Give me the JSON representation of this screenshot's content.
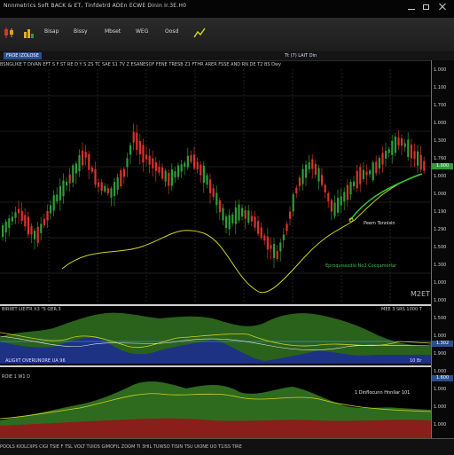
{
  "window": {
    "title": "Nnnmetrics Soft BACK & ET, Tinfdetrd ADEn ECWE Dinin Ir.3E.H0"
  },
  "toolbar": {
    "items": [
      "Bisap",
      "Bissy",
      "Mbset",
      "WEG",
      "Oosd"
    ],
    "icons": [
      "candle-icon",
      "bar-icon",
      "chart-icon"
    ]
  },
  "tabs": [
    "FROE IZOLOSE",
    "Tt (7) LAIT Din"
  ],
  "info_row": "BSNGLIKE T DIVAN  EFT S F ST RE D Y S ZS TC SAE S1 7V Z  ESANESOF FENE  TRESB Z1 FTHR ARER  FSSE AND RN DE T2 BS Dwy",
  "main_chart": {
    "annotation_1": "Peem Tonnlsin",
    "annotation_2": "Eproquissodio No2 Cocqamorlar",
    "watermark": "M2ET"
  },
  "indicator_1": {
    "header": "BIRIIET  LIEITR   X3  \"5 QER.3",
    "header_right": "MEE 3 SRS 1000 T",
    "label": "ALIGIIT OVERUNORE UA 96",
    "right_label": "10 Br"
  },
  "indicator_2": {
    "header": "ROIE 1 W1 D",
    "label": "1 Dinflocunn Hnnliar 101"
  },
  "price_axis": {
    "labels": [
      "1.000",
      "1.100",
      "1.700",
      "1.000",
      "1.300",
      "1.760",
      "1.000",
      "1.000",
      "1.190",
      "1.290",
      "1.500",
      "1.300",
      "1.000",
      "1.000",
      "1.500",
      "1.000",
      "1.900",
      "1.000",
      "1.000",
      "1.000",
      "1.000"
    ],
    "tags": [
      "1.000",
      "1.302",
      "1.600"
    ]
  },
  "bottom_bar": {
    "dates": "POOLS KIOLCIIPS   CIGI  TSIE  F  TSL  VOLT  TUIOS  GIMOFIL  ZOOM  TI  3HIL  TUWSO  TISIN  TSU  UIONE  UO  T1ISS  TIRE"
  },
  "colors": {
    "bull": "#2e9d3a",
    "bear": "#d8342c",
    "background": "#000000",
    "area_green": "#2f6b1e",
    "area_blue": "#1d2f8a",
    "area_red": "#8a1e1a",
    "ma_line": "#cfd21e"
  }
}
